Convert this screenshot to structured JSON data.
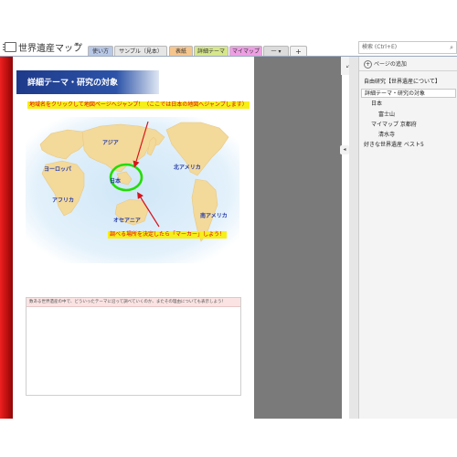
{
  "notebook": {
    "title": "世界遺産マップ",
    "caret": "▾"
  },
  "tabs": [
    "使い方",
    "サンプル（見本）",
    "表紙",
    "詳細テーマ",
    "マイマップ",
    "一 ▾",
    "+"
  ],
  "search": {
    "placeholder": "検索 (Ctrl+E)",
    "icon": "search-icon"
  },
  "page": {
    "title": "詳細テーマ・研究の対象",
    "note_top": "地域名をクリックして地図ページへジャンプ！（ここでは日本の地図へジャンプします）",
    "note_bottom": "調べる場所を決定したら「マーカー」しよう！",
    "regions": {
      "europe": "ヨーロッパ",
      "asia": "アジア",
      "japan": "日本",
      "north_america": "北アメリカ",
      "africa": "アフリカ",
      "oceania": "オセアニア",
      "south_america": "南アメリカ"
    },
    "textbox_header": "数ある世界遺産の中で、どういったテーマに沿って調べていくのか、またその理由についても表示しよう！"
  },
  "side": {
    "expand_icon": "⤢",
    "collapse_icon": "◂",
    "add_page": "ページの追加",
    "pages": [
      "自由研究【世界遺産について】",
      "詳細テーマ・研究の対象",
      "日本",
      "富士山",
      "マイマップ 京都府",
      "清水寺",
      "好きな世界遺産 ベスト5"
    ]
  },
  "colors": {
    "accent_red": "#c8102e",
    "banner_blue": "#1e3a8a",
    "highlight_yellow": "#f6ef1a",
    "marker_green": "#22dd00",
    "ocean": "#dceefa",
    "land": "#f3d99a"
  }
}
